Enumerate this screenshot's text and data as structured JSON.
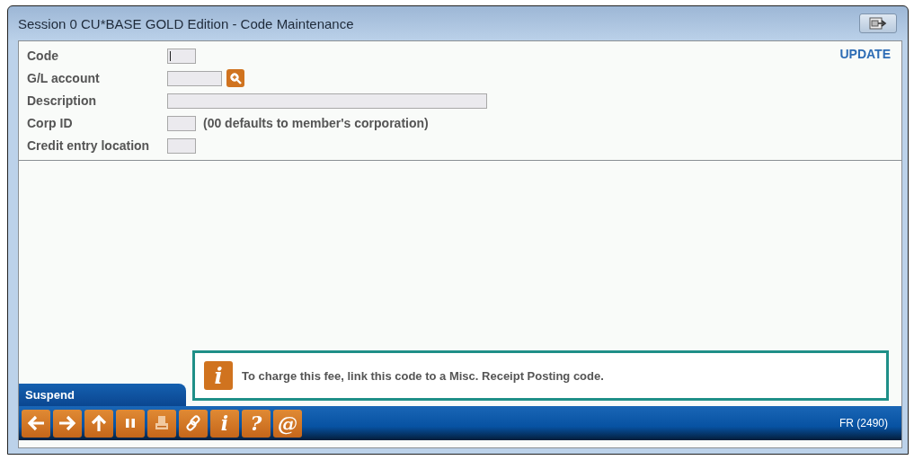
{
  "window": {
    "title": "Session 0 CU*BASE GOLD Edition - Code Maintenance"
  },
  "mode": "UPDATE",
  "fields": [
    {
      "label": "Code",
      "kind": "short",
      "focused": true,
      "lookup": false
    },
    {
      "label": "G/L account",
      "kind": "medium",
      "focused": false,
      "lookup": true
    },
    {
      "label": "Description",
      "kind": "long",
      "focused": false,
      "lookup": false
    },
    {
      "label": "Corp ID",
      "kind": "short",
      "focused": false,
      "lookup": false,
      "note": "(00 defaults to member's corporation)"
    },
    {
      "label": "Credit entry location",
      "kind": "short",
      "focused": false,
      "lookup": false
    }
  ],
  "info_message": {
    "icon": "i",
    "text": "To charge this fee, link this code to a Misc. Receipt Posting code."
  },
  "suspend_tab": "Suspend",
  "toolbar": [
    {
      "kind": "back"
    },
    {
      "kind": "forward"
    },
    {
      "kind": "up"
    },
    {
      "kind": "pause"
    },
    {
      "kind": "print"
    },
    {
      "kind": "link"
    },
    {
      "kind": "glyph",
      "label": "i"
    },
    {
      "kind": "glyph",
      "label": "?"
    },
    {
      "kind": "glyph",
      "label": "@"
    }
  ],
  "screen_id": "FR (2490)"
}
